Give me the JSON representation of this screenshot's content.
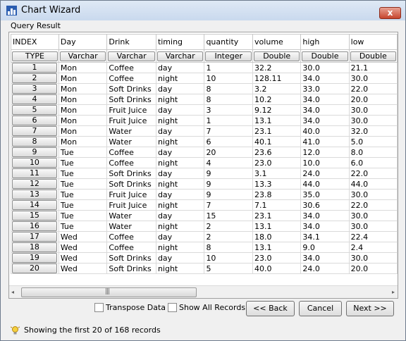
{
  "window": {
    "title": "Chart Wizard",
    "close_symbol": "x"
  },
  "section_label": "Query Result",
  "grid": {
    "columns": [
      "INDEX",
      "Day",
      "Drink",
      "timing",
      "quantity",
      "volume",
      "high",
      "low"
    ],
    "types": [
      "TYPE",
      "Varchar",
      "Varchar",
      "Varchar",
      "Integer",
      "Double",
      "Double",
      "Double"
    ],
    "rows": [
      [
        "1",
        "Mon",
        "Coffee",
        "day",
        "1",
        "32.2",
        "30.0",
        "21.1"
      ],
      [
        "2",
        "Mon",
        "Coffee",
        "night",
        "10",
        "128.11",
        "34.0",
        "30.0"
      ],
      [
        "3",
        "Mon",
        "Soft Drinks",
        "day",
        "8",
        "3.2",
        "33.0",
        "22.0"
      ],
      [
        "4",
        "Mon",
        "Soft Drinks",
        "night",
        "8",
        "10.2",
        "34.0",
        "20.0"
      ],
      [
        "5",
        "Mon",
        "Fruit Juice",
        "day",
        "3",
        "9.12",
        "34.0",
        "30.0"
      ],
      [
        "6",
        "Mon",
        "Fruit Juice",
        "night",
        "1",
        "13.1",
        "34.0",
        "30.0"
      ],
      [
        "7",
        "Mon",
        "Water",
        "day",
        "7",
        "23.1",
        "40.0",
        "32.0"
      ],
      [
        "8",
        "Mon",
        "Water",
        "night",
        "6",
        "40.1",
        "41.0",
        "5.0"
      ],
      [
        "9",
        "Tue",
        "Coffee",
        "day",
        "20",
        "23.6",
        "12.0",
        "8.0"
      ],
      [
        "10",
        "Tue",
        "Coffee",
        "night",
        "4",
        "23.0",
        "10.0",
        "6.0"
      ],
      [
        "11",
        "Tue",
        "Soft Drinks",
        "day",
        "9",
        "3.1",
        "24.0",
        "22.0"
      ],
      [
        "12",
        "Tue",
        "Soft Drinks",
        "night",
        "9",
        "13.3",
        "44.0",
        "44.0"
      ],
      [
        "13",
        "Tue",
        "Fruit Juice",
        "day",
        "9",
        "23.8",
        "35.0",
        "30.0"
      ],
      [
        "14",
        "Tue",
        "Fruit Juice",
        "night",
        "7",
        "7.1",
        "30.6",
        "22.0"
      ],
      [
        "15",
        "Tue",
        "Water",
        "day",
        "15",
        "23.1",
        "34.0",
        "30.0"
      ],
      [
        "16",
        "Tue",
        "Water",
        "night",
        "2",
        "13.1",
        "34.0",
        "30.0"
      ],
      [
        "17",
        "Wed",
        "Coffee",
        "day",
        "2",
        "18.0",
        "34.1",
        "22.4"
      ],
      [
        "18",
        "Wed",
        "Coffee",
        "night",
        "8",
        "13.1",
        "9.0",
        "2.4"
      ],
      [
        "19",
        "Wed",
        "Soft Drinks",
        "day",
        "10",
        "23.0",
        "34.0",
        "30.0"
      ],
      [
        "20",
        "Wed",
        "Soft Drinks",
        "night",
        "5",
        "40.0",
        "24.0",
        "20.0"
      ]
    ]
  },
  "scrollbar": {
    "left_arrow": "◂",
    "right_arrow": "▸",
    "grip": "|||"
  },
  "options": {
    "transpose_label": "Transpose Data",
    "show_all_label": "Show All Records"
  },
  "buttons": {
    "back_label": "<< Back",
    "cancel_label": "Cancel",
    "next_label": "Next >>"
  },
  "status": {
    "text": "Showing the first 20 of 168 records"
  },
  "colors": {
    "titlebar": "#c9d9ee",
    "close": "#c7452d",
    "window_bg": "#f0f0f0"
  },
  "icons": {
    "app": "chart-wizard-icon",
    "status": "lightbulb-icon"
  }
}
